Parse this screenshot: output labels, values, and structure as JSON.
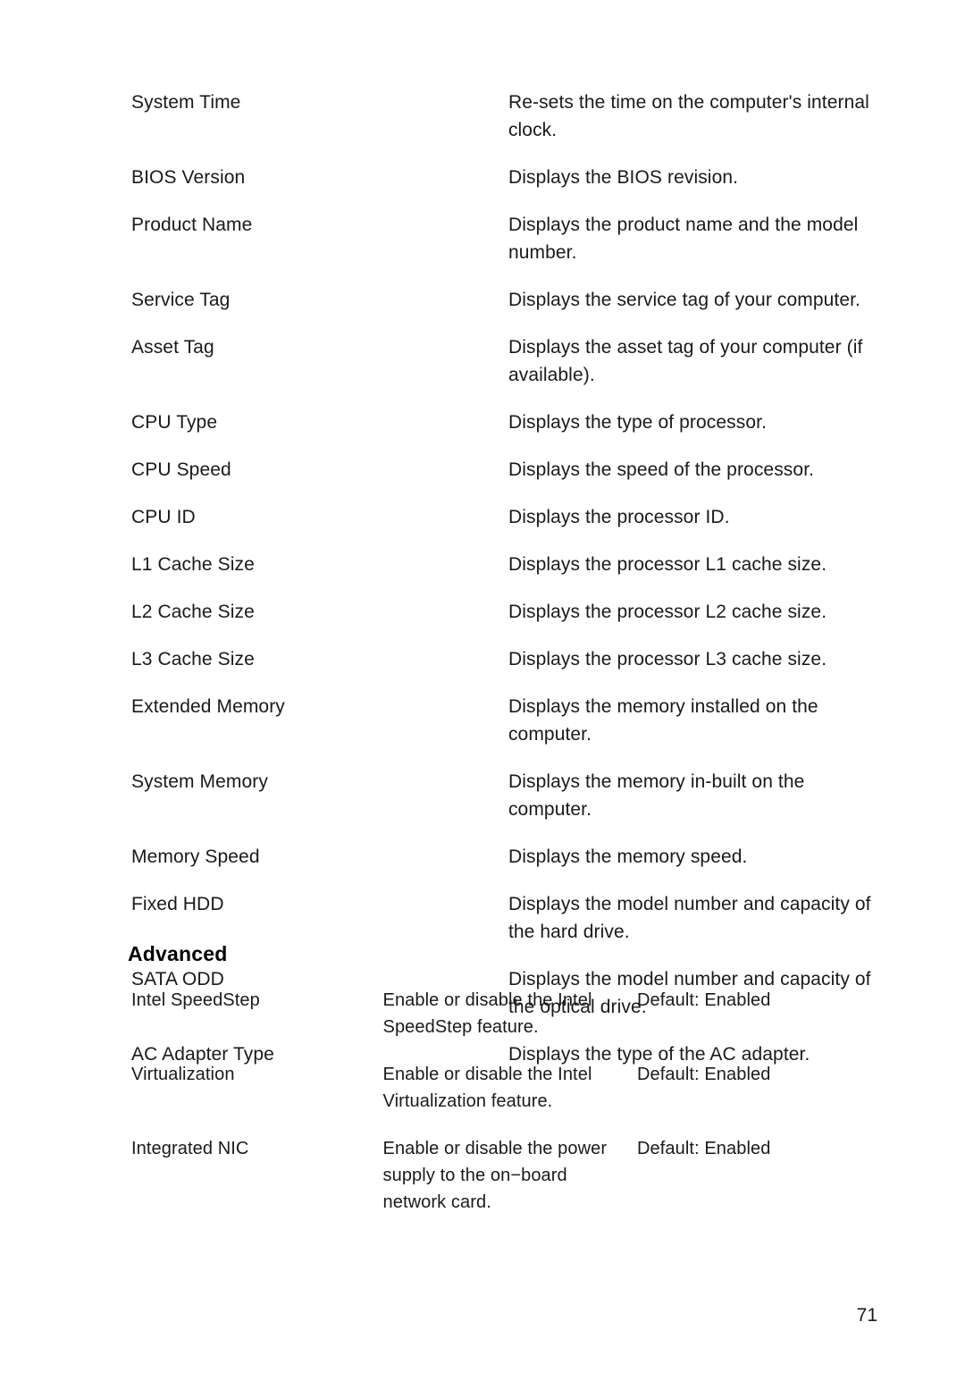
{
  "document": {
    "page_number": "71",
    "text_color": "#1a1a1a",
    "heading_color": "#000000",
    "background_color": "#ffffff"
  },
  "system_info": {
    "rows": [
      {
        "option": "System Time",
        "description": "Re-sets the time on the computer's internal clock."
      },
      {
        "option": "BIOS Version",
        "description": "Displays the BIOS revision."
      },
      {
        "option": "Product Name",
        "description": "Displays the product name and the model number."
      },
      {
        "option": "Service Tag",
        "description": "Displays the service tag of your computer."
      },
      {
        "option": "Asset Tag",
        "description": "Displays the asset tag of your computer (if available)."
      },
      {
        "option": "CPU Type",
        "description": "Displays the type of processor."
      },
      {
        "option": "CPU Speed",
        "description": "Displays the speed of the processor."
      },
      {
        "option": "CPU ID",
        "description": "Displays the processor ID."
      },
      {
        "option": "L1 Cache Size",
        "description": "Displays the processor L1 cache size."
      },
      {
        "option": "L2 Cache Size",
        "description": "Displays the processor L2 cache size."
      },
      {
        "option": "L3 Cache Size",
        "description": "Displays the processor L3 cache size."
      },
      {
        "option": "Extended Memory",
        "description": "Displays the memory installed on the computer."
      },
      {
        "option": "System Memory",
        "description": "Displays the memory in-built on the computer."
      },
      {
        "option": "Memory Speed",
        "description": "Displays the memory speed."
      },
      {
        "option": "Fixed HDD",
        "description": "Displays the model number and capacity of the hard drive."
      },
      {
        "option": "SATA ODD",
        "description": "Displays the model number and capacity of the optical drive."
      },
      {
        "option": "AC Adapter Type",
        "description": "Displays the type of the AC adapter."
      }
    ]
  },
  "advanced": {
    "heading": "Advanced",
    "rows": [
      {
        "option": "Intel SpeedStep",
        "description": "Enable or disable the Intel SpeedStep feature.",
        "default": "Default: Enabled"
      },
      {
        "option": "Virtualization",
        "description": "Enable or disable the Intel Virtualization feature.",
        "default": "Default: Enabled"
      },
      {
        "option": "Integrated NIC",
        "description": "Enable or disable the power supply to the on−board network card.",
        "default": "Default: Enabled"
      }
    ]
  }
}
